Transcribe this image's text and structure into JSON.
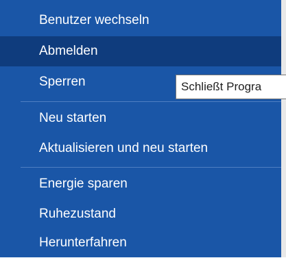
{
  "menu": {
    "items": [
      {
        "label": "Benutzer wechseln"
      },
      {
        "label": "Abmelden"
      },
      {
        "label": "Sperren"
      },
      {
        "label": "Neu starten"
      },
      {
        "label": "Aktualisieren und neu starten"
      },
      {
        "label": "Energie sparen"
      },
      {
        "label": "Ruhezustand"
      },
      {
        "label": "Herunterfahren"
      }
    ],
    "hovered_item": "Abmelden"
  },
  "tooltip": {
    "text": "Schließt Progra"
  },
  "colors": {
    "menu_background": "#1a56a7",
    "hover_background": "#0f3c7d",
    "text": "#ffffff",
    "divider": "#4f7fc2"
  }
}
